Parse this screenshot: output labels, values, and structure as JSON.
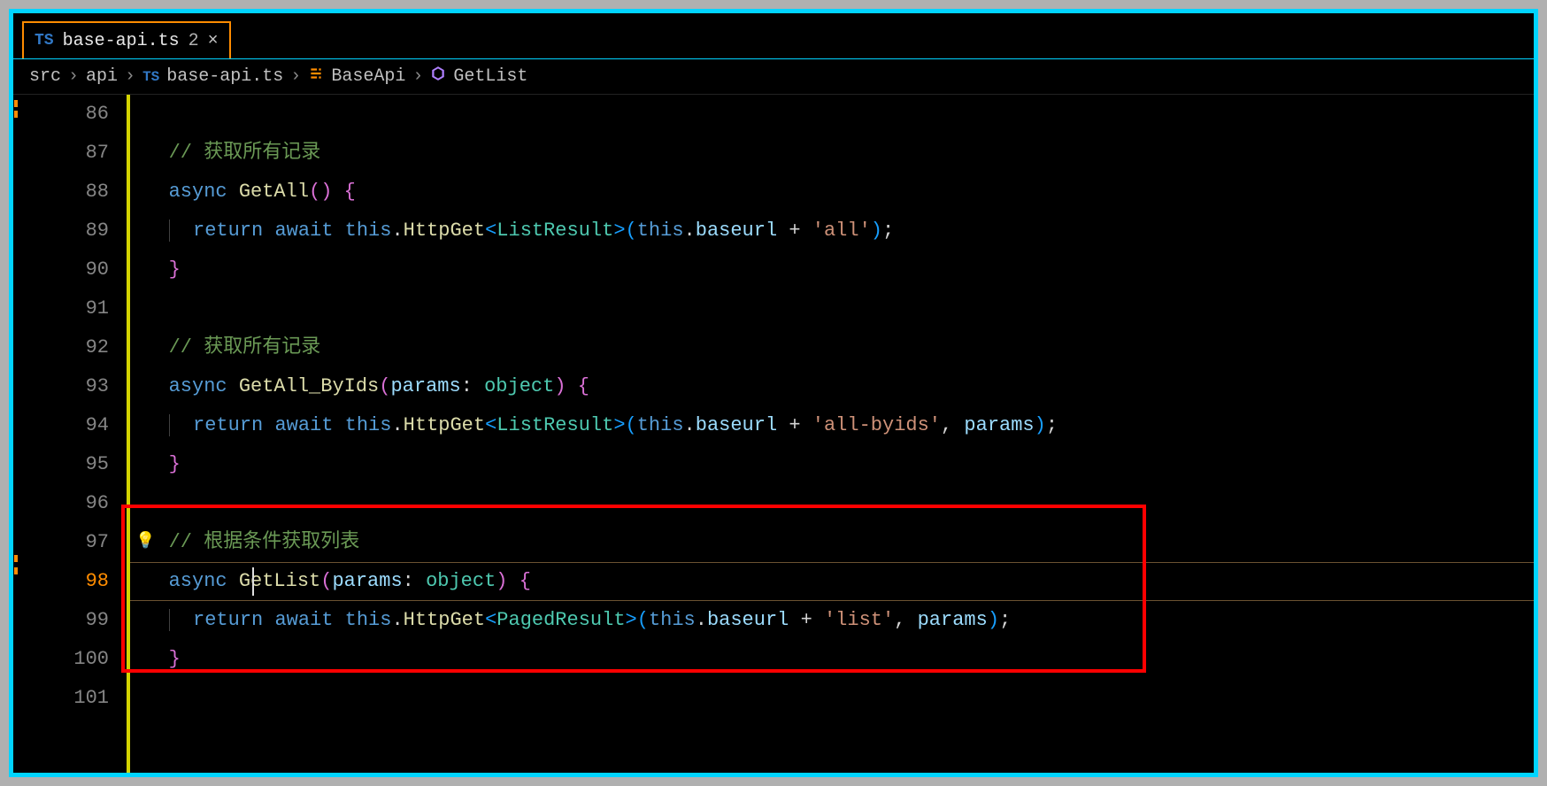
{
  "tab": {
    "icon": "TS",
    "name": "base-api.ts",
    "count": "2",
    "close": "×"
  },
  "breadcrumb": {
    "p1": "src",
    "p2": "api",
    "ts": "TS",
    "file": "base-api.ts",
    "class": "BaseApi",
    "method": "GetList"
  },
  "lines": {
    "86": "86",
    "87": "87",
    "88": "88",
    "89": "89",
    "90": "90",
    "91": "91",
    "92": "92",
    "93": "93",
    "94": "94",
    "95": "95",
    "96": "96",
    "97": "97",
    "98": "98",
    "99": "99",
    "100": "100",
    "101": "101"
  },
  "code": {
    "c87": "// 获取所有记录",
    "c92": "// 获取所有记录",
    "c97": "// 根据条件获取列表",
    "async": "async",
    "GetAll": "GetAll",
    "GetAll_ByIds": "GetAll_ByIds",
    "GetList": "GetList",
    "params": "params",
    "object": "object",
    "return": "return",
    "await": "await",
    "this": "this",
    "HttpGet": "HttpGet",
    "ListResult": "ListResult",
    "PagedResult": "PagedResult",
    "baseurl": "baseurl",
    "all": "'all'",
    "allbyids": "'all-byids'",
    "list": "'list'",
    "paramsArg": "params"
  }
}
